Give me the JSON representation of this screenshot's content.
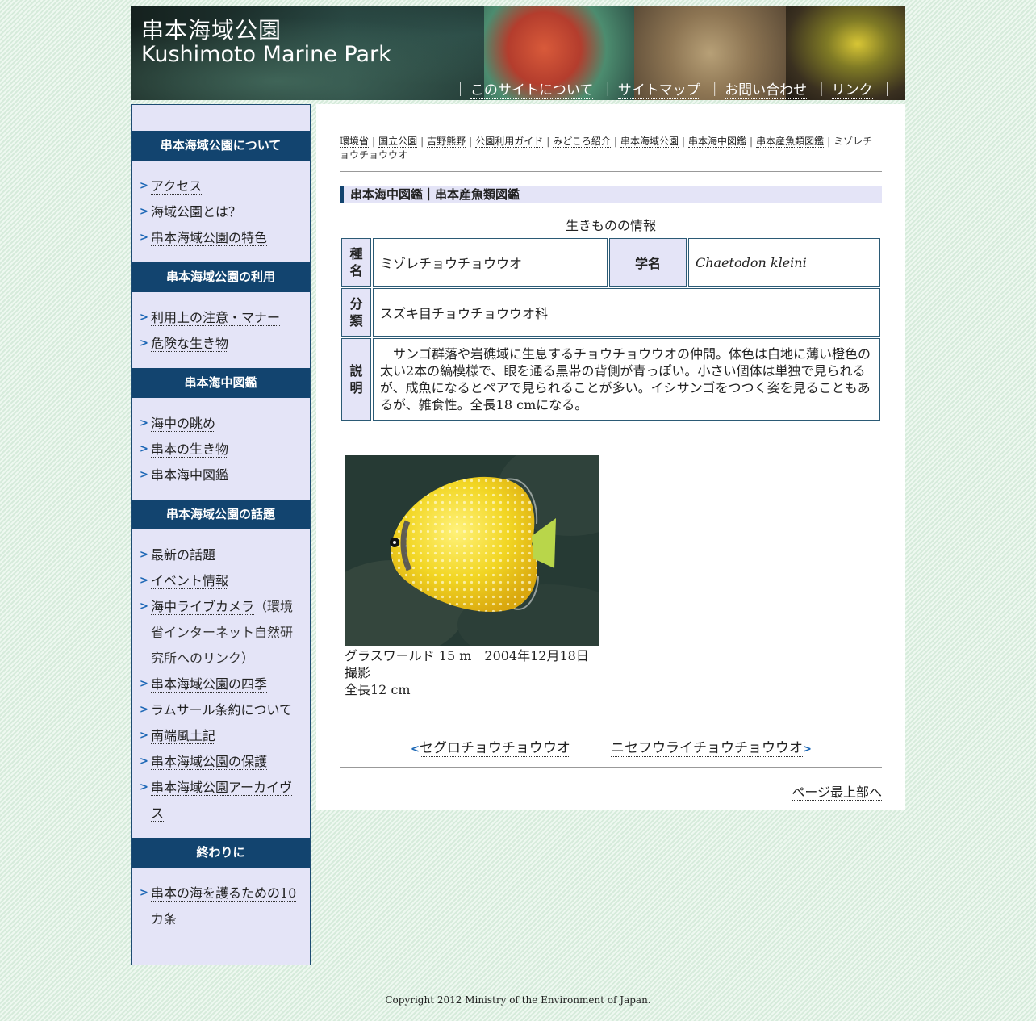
{
  "header": {
    "title_ja": "串本海域公園",
    "title_en": "Kushimoto Marine Park",
    "nav": [
      {
        "label": "このサイトについて"
      },
      {
        "label": "サイトマップ"
      },
      {
        "label": "お問い合わせ"
      },
      {
        "label": "リンク"
      }
    ],
    "separator": "｜"
  },
  "sidebar": {
    "sections": [
      {
        "title": "串本海域公園について",
        "items": [
          "アクセス",
          "海域公園とは？",
          "串本海域公園の特色"
        ]
      },
      {
        "title": "串本海域公園の利用",
        "items": [
          "利用上の注意・マナー",
          "危険な生き物"
        ]
      },
      {
        "title": "串本海中図鑑",
        "items": [
          "海中の眺め",
          "串本の生き物",
          "串本海中図鑑"
        ]
      },
      {
        "title": "串本海域公園の話題",
        "items": [
          "最新の話題",
          "イベント情報",
          "海中ライブカメラ",
          "串本海域公園の四季",
          "ラムサール条約について",
          "南端風土記",
          "串本海域公園の保護",
          "串本海域公園アーカイヴス"
        ]
      },
      {
        "title": "終わりに",
        "items": [
          "串本の海を護るための10カ条"
        ]
      }
    ],
    "live_camera_note": "（環境省インターネット自然研究所へのリンク）"
  },
  "breadcrumb": {
    "links": [
      "環境省",
      "国立公園",
      "吉野熊野",
      "公園利用ガイド",
      "みどころ紹介",
      "串本海域公園",
      "串本海中図鑑",
      "串本産魚類図鑑"
    ],
    "current": "ミゾレチョウチョウウオ",
    "separator": "|"
  },
  "section_heading": "串本海中図鑑｜串本産魚類図鑑",
  "info_table": {
    "caption": "生きものの情報",
    "species_label": "種名",
    "species_value": "ミゾレチョウチョウウオ",
    "scientific_label": "学名",
    "scientific_value": "Chaetodon kleini",
    "classification_label": "分類",
    "classification_value": "スズキ目チョウチョウウオ科",
    "description_label": "説明",
    "description_value": "サンゴ群落や岩礁域に生息するチョウチョウウオの仲間。体色は白地に薄い橙色の太い2本の縞模様で、眼を通る黒帯の背側が青っぽい。小さい個体は単独で見られるが、成魚になるとペアで見られることが多い。イシサンゴをつつく姿を見ることもあるが、雑食性。全長18 cmになる。"
  },
  "photo": {
    "caption_line1": "グラスワールド 15 m　2004年12月18日撮影",
    "caption_line2": "全長12 cm"
  },
  "pager": {
    "prev_label": "セグロチョウチョウウオ",
    "next_label": "ニセフウライチョウチョウウオ",
    "prev_marker": "<",
    "next_marker": ">"
  },
  "to_top": "ページ最上部へ",
  "footer": {
    "copyright": "Copyright 2012 Ministry of the Environment of Japan."
  },
  "colors": {
    "nav_dark_blue": "#12446f",
    "sidebar_bg": "#e4e4f7",
    "arrow_blue": "#1a66b5"
  }
}
